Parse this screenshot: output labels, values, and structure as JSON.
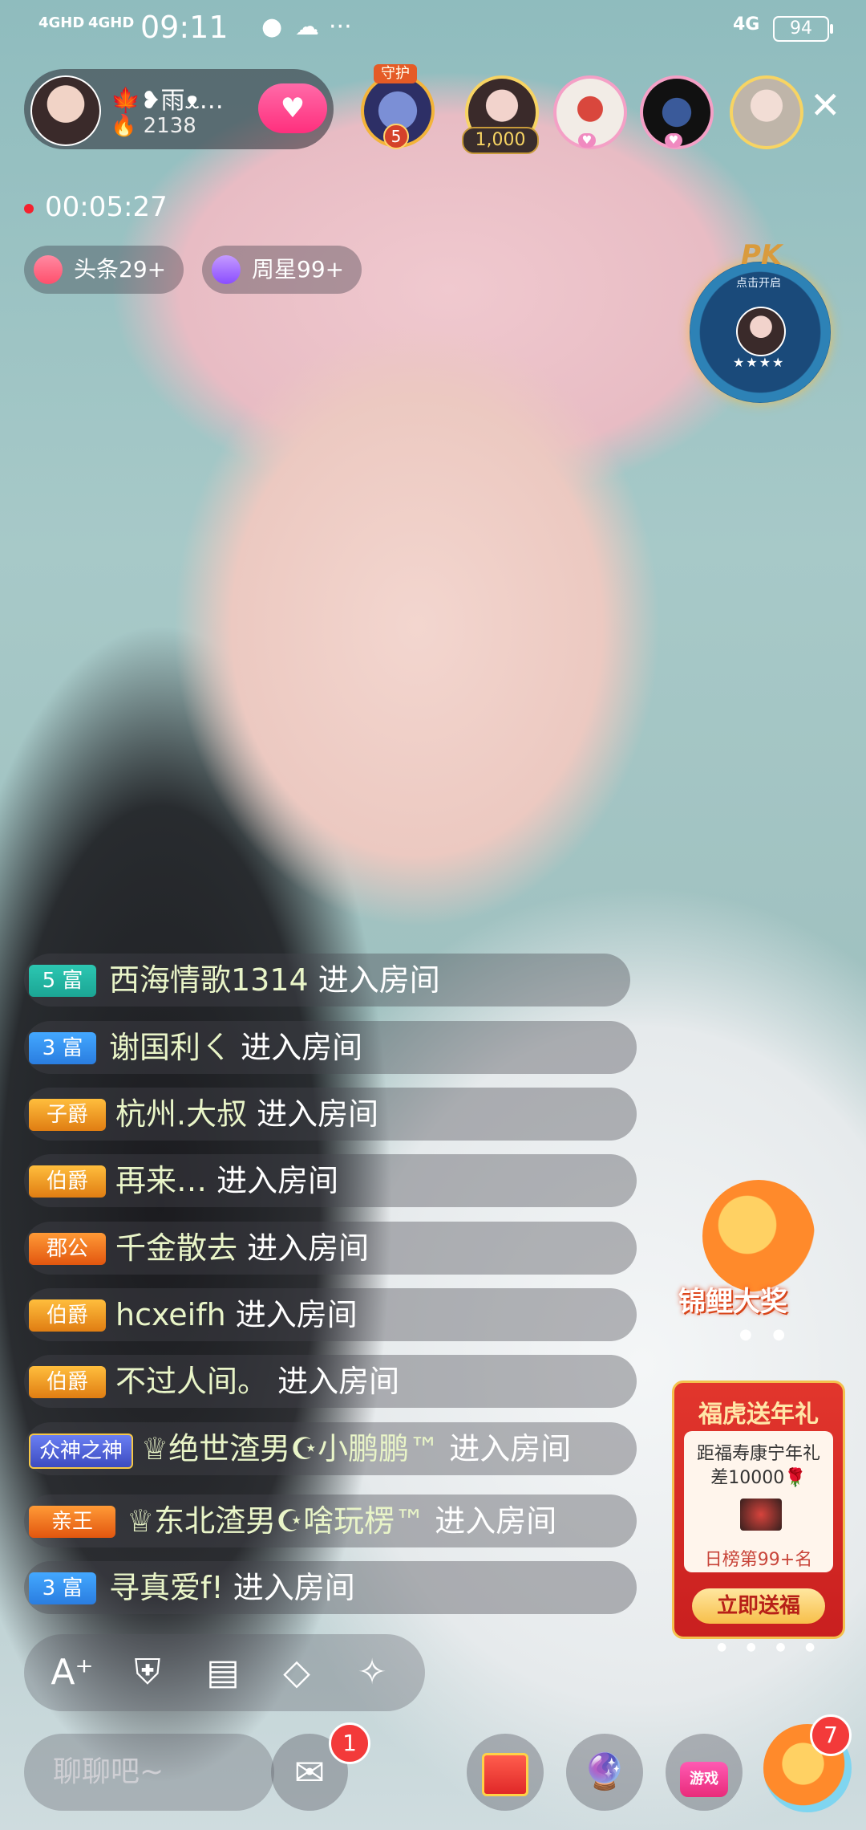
{
  "status_bar": {
    "signal1": "4GHD",
    "signal2": "4GHD",
    "time": "09:11",
    "net_right": "4G",
    "battery": "94",
    "more_dots": "···"
  },
  "host": {
    "name": "🍁❥雨ᴥ…",
    "fans": "2138",
    "follow_icon": "heart-hands-icon"
  },
  "guard": {
    "tag": "守护",
    "level": "5"
  },
  "viewers": {
    "first_count": "1,000"
  },
  "close_label": "✕",
  "live_timer": "00:05:27",
  "chips": {
    "headline": "头条29+",
    "weekly_star": "周星99+"
  },
  "pk": {
    "title": "PK",
    "hint": "点击开启",
    "stars": "★★★★"
  },
  "messages": [
    {
      "badge": "5 富",
      "user": "西海情歌1314",
      "action": " 进入房间"
    },
    {
      "badge": "3 富",
      "user": "谢国利ㄑ",
      "action": " 进入房间"
    },
    {
      "badge": "子爵",
      "user": "杭州.大叔",
      "action": " 进入房间"
    },
    {
      "badge": "伯爵",
      "user": "再来…",
      "action": " 进入房间"
    },
    {
      "badge": "郡公",
      "user": "千金散去",
      "action": " 进入房间"
    },
    {
      "badge": "伯爵",
      "user": "hcxeifh",
      "action": " 进入房间"
    },
    {
      "badge": "伯爵",
      "user": "不过人间。",
      "action": " 进入房间"
    },
    {
      "badge": "众神之神",
      "user": "♕绝世渣男☪小鹏鹏™",
      "action": " 进入房间"
    },
    {
      "badge": "亲王",
      "user": "♕东北渣男☪啥玩楞™",
      "action": " 进入房间"
    },
    {
      "badge": "3 富",
      "user": "寻真爱f!",
      "action": " 进入房间"
    }
  ],
  "carp_promo": {
    "label": "锦鲤大奖",
    "dots": "● ●"
  },
  "fu_card": {
    "title": "福虎送年礼",
    "line1": "距福寿康宁年礼",
    "line2": "差10000🌹",
    "rank": "日榜第99+名",
    "button": "立即送福",
    "dots": "● ● ● ●"
  },
  "toolbar": {
    "font_icon": "A⁺",
    "guard_icon": "shield-icon",
    "note_icon": "note-icon",
    "tag_icon": "tag-icon",
    "magic_icon": "magic-wand-icon"
  },
  "bottom": {
    "chat_placeholder": "聊聊吧~",
    "mail_badge": "1",
    "game_label": "游戏",
    "carp_badge": "7"
  }
}
